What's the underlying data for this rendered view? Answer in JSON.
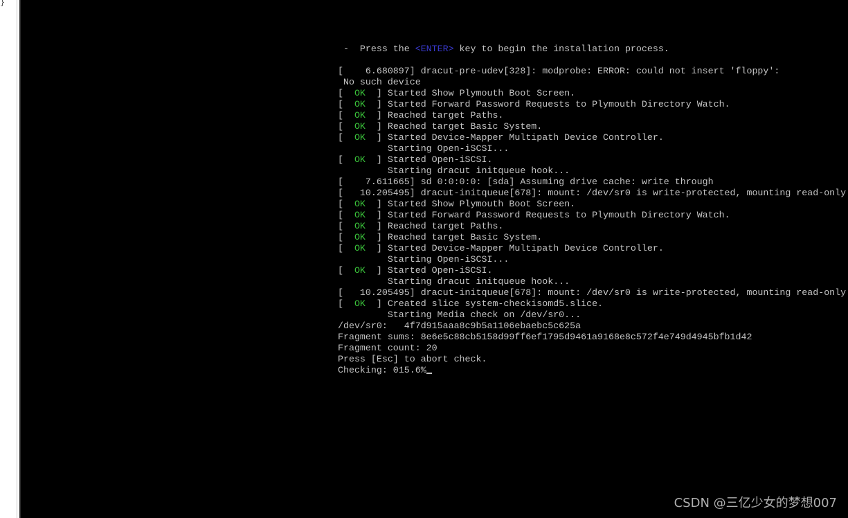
{
  "console": {
    "lines": [
      {
        "segments": [
          {
            "t": " -  Press the ",
            "c": "n"
          },
          {
            "t": "<ENTER>",
            "c": "enter"
          },
          {
            "t": " key to begin the installation process.",
            "c": "n"
          }
        ]
      },
      {
        "segments": [
          {
            "t": "",
            "c": "n"
          }
        ]
      },
      {
        "segments": [
          {
            "t": "[    6.680897] dracut-pre-udev[328]: modprobe: ERROR: could not insert 'floppy':",
            "c": "n"
          }
        ]
      },
      {
        "segments": [
          {
            "t": " No such device",
            "c": "n"
          }
        ]
      },
      {
        "segments": [
          {
            "t": "[  ",
            "c": "n"
          },
          {
            "t": "OK",
            "c": "ok"
          },
          {
            "t": "  ] Started Show Plymouth Boot Screen.",
            "c": "n"
          }
        ]
      },
      {
        "segments": [
          {
            "t": "[  ",
            "c": "n"
          },
          {
            "t": "OK",
            "c": "ok"
          },
          {
            "t": "  ] Started Forward Password Requests to Plymouth Directory Watch.",
            "c": "n"
          }
        ]
      },
      {
        "segments": [
          {
            "t": "[  ",
            "c": "n"
          },
          {
            "t": "OK",
            "c": "ok"
          },
          {
            "t": "  ] Reached target Paths.",
            "c": "n"
          }
        ]
      },
      {
        "segments": [
          {
            "t": "[  ",
            "c": "n"
          },
          {
            "t": "OK",
            "c": "ok"
          },
          {
            "t": "  ] Reached target Basic System.",
            "c": "n"
          }
        ]
      },
      {
        "segments": [
          {
            "t": "[  ",
            "c": "n"
          },
          {
            "t": "OK",
            "c": "ok"
          },
          {
            "t": "  ] Started Device-Mapper Multipath Device Controller.",
            "c": "n"
          }
        ]
      },
      {
        "segments": [
          {
            "t": "         Starting Open-iSCSI...",
            "c": "n"
          }
        ]
      },
      {
        "segments": [
          {
            "t": "[  ",
            "c": "n"
          },
          {
            "t": "OK",
            "c": "ok"
          },
          {
            "t": "  ] Started Open-iSCSI.",
            "c": "n"
          }
        ]
      },
      {
        "segments": [
          {
            "t": "         Starting dracut initqueue hook...",
            "c": "n"
          }
        ]
      },
      {
        "segments": [
          {
            "t": "[    7.611665] sd 0:0:0:0: [sda] Assuming drive cache: write through",
            "c": "n"
          }
        ]
      },
      {
        "segments": [
          {
            "t": "[   10.205495] dracut-initqueue[678]: mount: /dev/sr0 is write-protected, mounting read-only",
            "c": "n"
          }
        ]
      },
      {
        "segments": [
          {
            "t": "[  ",
            "c": "n"
          },
          {
            "t": "OK",
            "c": "ok"
          },
          {
            "t": "  ] Started Show Plymouth Boot Screen.",
            "c": "n"
          }
        ]
      },
      {
        "segments": [
          {
            "t": "[  ",
            "c": "n"
          },
          {
            "t": "OK",
            "c": "ok"
          },
          {
            "t": "  ] Started Forward Password Requests to Plymouth Directory Watch.",
            "c": "n"
          }
        ]
      },
      {
        "segments": [
          {
            "t": "[  ",
            "c": "n"
          },
          {
            "t": "OK",
            "c": "ok"
          },
          {
            "t": "  ] Reached target Paths.",
            "c": "n"
          }
        ]
      },
      {
        "segments": [
          {
            "t": "[  ",
            "c": "n"
          },
          {
            "t": "OK",
            "c": "ok"
          },
          {
            "t": "  ] Reached target Basic System.",
            "c": "n"
          }
        ]
      },
      {
        "segments": [
          {
            "t": "[  ",
            "c": "n"
          },
          {
            "t": "OK",
            "c": "ok"
          },
          {
            "t": "  ] Started Device-Mapper Multipath Device Controller.",
            "c": "n"
          }
        ]
      },
      {
        "segments": [
          {
            "t": "         Starting Open-iSCSI...",
            "c": "n"
          }
        ]
      },
      {
        "segments": [
          {
            "t": "[  ",
            "c": "n"
          },
          {
            "t": "OK",
            "c": "ok"
          },
          {
            "t": "  ] Started Open-iSCSI.",
            "c": "n"
          }
        ]
      },
      {
        "segments": [
          {
            "t": "         Starting dracut initqueue hook...",
            "c": "n"
          }
        ]
      },
      {
        "segments": [
          {
            "t": "[   10.205495] dracut-initqueue[678]: mount: /dev/sr0 is write-protected, mounting read-only",
            "c": "n"
          }
        ]
      },
      {
        "segments": [
          {
            "t": "[  ",
            "c": "n"
          },
          {
            "t": "OK",
            "c": "ok"
          },
          {
            "t": "  ] Created slice system-checkisomd5.slice.",
            "c": "n"
          }
        ]
      },
      {
        "segments": [
          {
            "t": "         Starting Media check on /dev/sr0...",
            "c": "n"
          }
        ]
      },
      {
        "segments": [
          {
            "t": "/dev/sr0:   4f7d915aaa8c9b5a1106ebaebc5c625a",
            "c": "n"
          }
        ]
      },
      {
        "segments": [
          {
            "t": "Fragment sums: 8e6e5c88cb5158d99ff6ef1795d9461a9168e8c572f4e749d4945bfb1d42",
            "c": "n"
          }
        ]
      },
      {
        "segments": [
          {
            "t": "Fragment count: 20",
            "c": "n"
          }
        ]
      },
      {
        "segments": [
          {
            "t": "Press [Esc] to abort check.",
            "c": "n"
          }
        ]
      },
      {
        "segments": [
          {
            "t": "Checking: 015.6%",
            "c": "n"
          }
        ],
        "cursor": true
      }
    ]
  },
  "left_strip": {
    "brace": "}"
  },
  "watermark": {
    "text": "CSDN @三亿少女的梦想007"
  },
  "colors": {
    "background": "#000000",
    "text": "#c4c4c4",
    "ok": "#3bc43b",
    "enter_key": "#3a3ad0"
  }
}
